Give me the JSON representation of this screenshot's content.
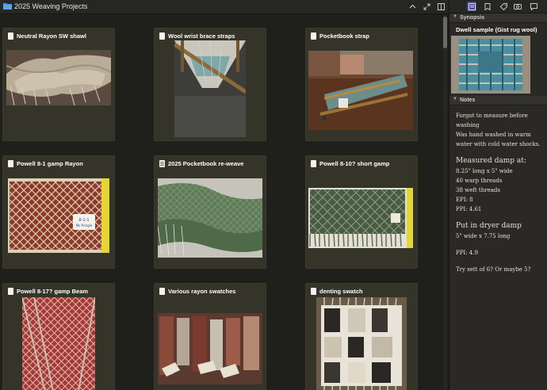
{
  "window": {
    "title": "2025 Weaving Projects"
  },
  "cards": [
    {
      "title": "Neutral Rayon SW shawl",
      "doc_icon": "document-icon"
    },
    {
      "title": "Wool wrist brace straps",
      "doc_icon": "document-icon"
    },
    {
      "title": "Pocketbook strap",
      "doc_icon": "document-icon"
    },
    {
      "title": "Powell 8-1 gamp Rayon",
      "doc_icon": "document-icon"
    },
    {
      "title": "2025 Pocketbook re-weave",
      "doc_icon": "document-text-icon"
    },
    {
      "title": "Powell 8-10? short gamp",
      "doc_icon": "document-icon"
    },
    {
      "title": "Powell 8-17? gamp Beam",
      "doc_icon": "document-icon"
    },
    {
      "title": "Various rayon swatches",
      "doc_icon": "document-icon"
    },
    {
      "title": "denting swatch",
      "doc_icon": "document-icon"
    }
  ],
  "photo_tags": {
    "gamp_tag_line1": "8-1-1",
    "gamp_tag_line2": "Ms Pringle"
  },
  "inspector": {
    "synopsis_header": "Synopsis",
    "synopsis_title": "Dwell sample (Gist rug wool)",
    "notes_header": "Notes",
    "notes_lines": [
      {
        "text": "Forgot to measure before",
        "style": ""
      },
      {
        "text": "washing",
        "style": ""
      },
      {
        "text": "Was hand washed in warm",
        "style": ""
      },
      {
        "text": "water with cold water shocks.",
        "style": ""
      },
      {
        "text": "Measured damp at:",
        "style": "big gap"
      },
      {
        "text": "8.25\" long x 5\" wide",
        "style": ""
      },
      {
        "text": "40 warp threads",
        "style": ""
      },
      {
        "text": "38 weft threads",
        "style": ""
      },
      {
        "text": "EPI: 8",
        "style": ""
      },
      {
        "text": "PPI: 4.61",
        "style": ""
      },
      {
        "text": "Put in dryer damp",
        "style": "big gap"
      },
      {
        "text": "5\" wide x 7.75 long",
        "style": ""
      },
      {
        "text": "PPI: 4.9",
        "style": "gap"
      },
      {
        "text": "Try sett of 6? Or maybe 5?",
        "style": "gap"
      }
    ]
  },
  "colors": {
    "accent": "#4a4f8a",
    "card_bg": "#343428",
    "panel_bg": "#2a2925"
  }
}
